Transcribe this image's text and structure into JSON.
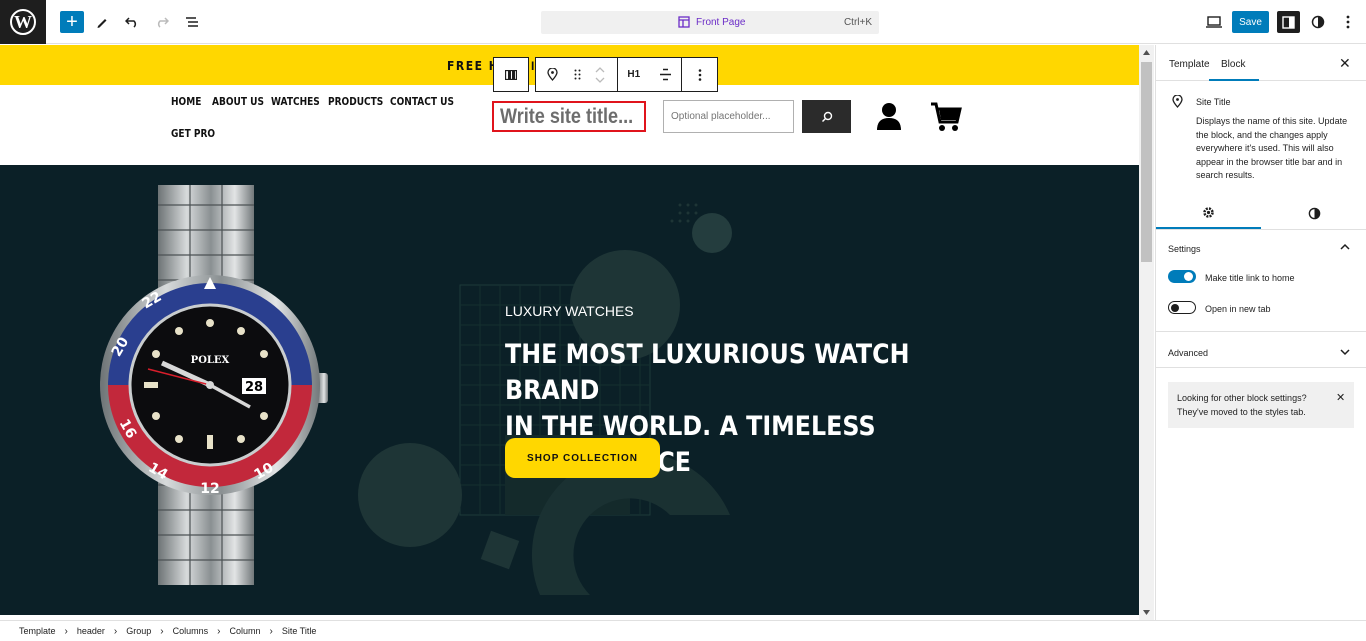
{
  "toolbar": {
    "document_title": "Front Page",
    "shortcut": "Ctrl+K",
    "save_label": "Save"
  },
  "canvas": {
    "promo_text": "FREE HE",
    "promo_text_tail": "I",
    "nav": [
      "HOME",
      "ABOUT US",
      "WATCHES",
      "PRODUCTS",
      "CONTACT US",
      "GET PRO"
    ],
    "site_title_placeholder": "Write site title...",
    "search_placeholder": "Optional placeholder...",
    "block_toolbar": {
      "heading_level": "H1"
    },
    "hero": {
      "kicker": "LUXURY WATCHES",
      "heading": "THE MOST LUXURIOUS WATCH BRAND\nIN THE WORLD. A TIMELESS MASTERPIECE",
      "button_label": "SHOP COLLECTION",
      "watch_brand": "POLEX",
      "watch_date": "28"
    }
  },
  "sidebar": {
    "tabs": [
      "Template",
      "Block"
    ],
    "active_tab": "Block",
    "block_title": "Site Title",
    "block_description": "Displays the name of this site. Update the block, and the changes apply everywhere it's used. This will also appear in the browser title bar and in search results.",
    "settings_title": "Settings",
    "toggles": [
      {
        "label": "Make title link to home",
        "on": true
      },
      {
        "label": "Open in new tab",
        "on": false
      }
    ],
    "advanced_title": "Advanced",
    "notice": "Looking for other block settings? They've moved to the styles tab."
  },
  "breadcrumb": [
    "Template",
    "header",
    "Group",
    "Columns",
    "Column",
    "Site Title"
  ],
  "colors": {
    "accent": "#007cba",
    "promo_yellow": "#ffd700",
    "hero_bg": "#0b2027",
    "title_outline": "#e0141c"
  }
}
